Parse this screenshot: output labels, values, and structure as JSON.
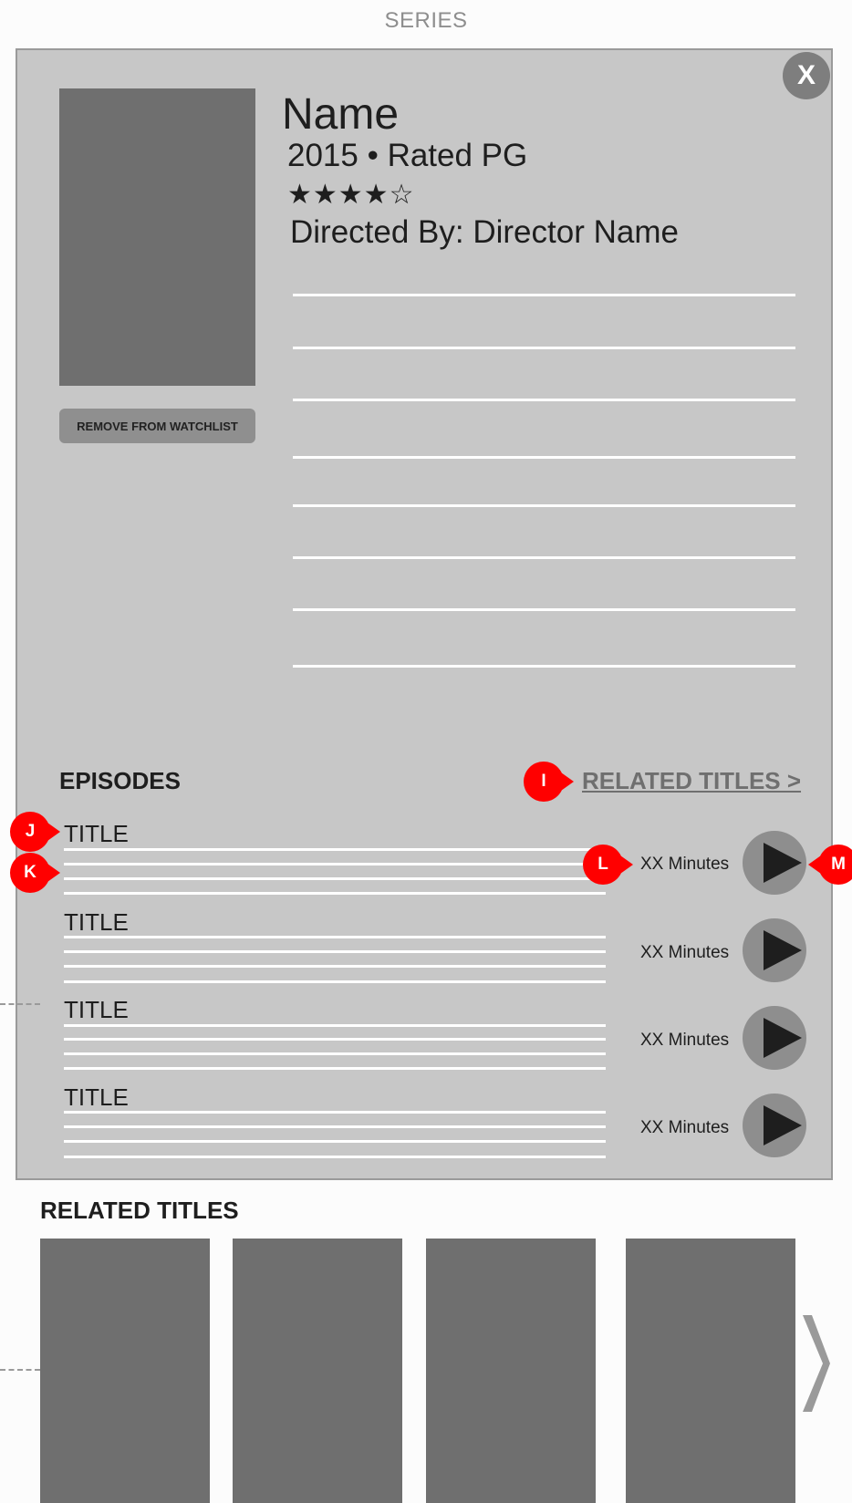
{
  "page_label": "SERIES",
  "detail": {
    "close_label": "X",
    "name": "Name",
    "meta": "2015 • Rated PG",
    "rating": {
      "value": 4,
      "max": 5,
      "display": "★★★★☆"
    },
    "director": "Directed By: Director Name",
    "watchlist_button": "REMOVE FROM WATCHLIST"
  },
  "episodes": {
    "heading": "EPISODES",
    "related_link": "RELATED TITLES >",
    "items": [
      {
        "title": "TITLE",
        "minutes": "XX Minutes"
      },
      {
        "title": "TITLE",
        "minutes": "XX Minutes"
      },
      {
        "title": "TITLE",
        "minutes": "XX Minutes"
      },
      {
        "title": "TITLE",
        "minutes": "XX Minutes"
      }
    ]
  },
  "annotations": [
    "I",
    "J",
    "K",
    "L",
    "M"
  ],
  "related": {
    "heading": "RELATED TITLES",
    "card_count": 4
  },
  "colors": {
    "modal_bg": "#c7c7c7",
    "placeholder": "#6f6f6f",
    "marker": "#ff0000",
    "text": "#1e1e1e"
  }
}
